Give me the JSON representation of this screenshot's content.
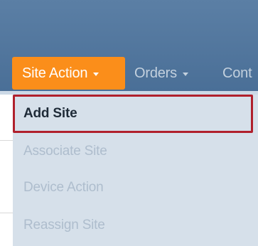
{
  "nav": {
    "items": [
      {
        "label": "Site Action"
      },
      {
        "label": "Orders"
      },
      {
        "label": "Cont"
      }
    ]
  },
  "dropdown": {
    "items": [
      {
        "label": "Add Site"
      },
      {
        "label": "Associate Site"
      },
      {
        "label": "Device Action"
      },
      {
        "label": "Reassign Site"
      }
    ]
  },
  "colors": {
    "header": "#4a6f97",
    "accent": "#fb8e1a",
    "menu_bg": "#d6e0ea",
    "highlight": "#b0202c"
  }
}
